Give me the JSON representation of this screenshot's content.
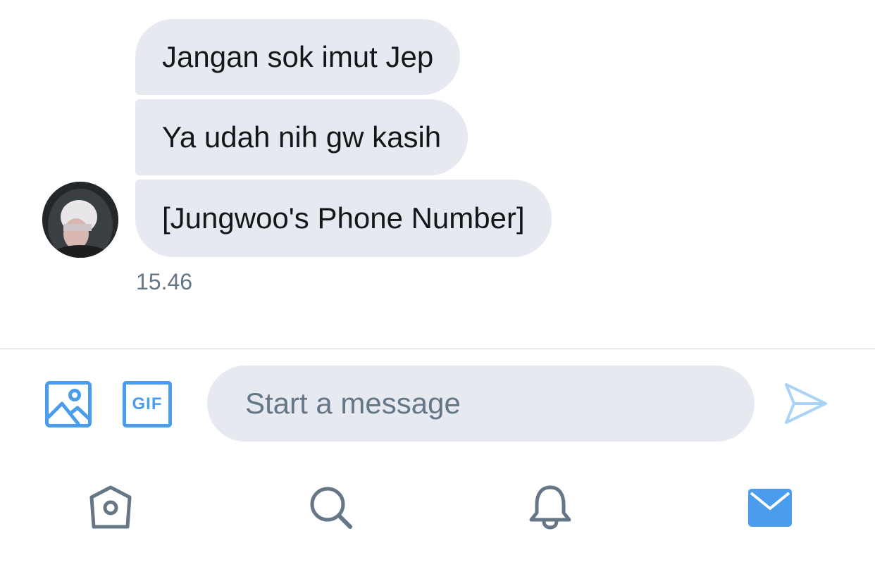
{
  "conversation": {
    "messages": [
      {
        "text": "Jangan sok imut Jep"
      },
      {
        "text": "Ya udah nih gw kasih"
      },
      {
        "text": "[Jungwoo's Phone Number]"
      }
    ],
    "timestamp": "15.46",
    "avatar_icon": "user-avatar"
  },
  "composer": {
    "photo_icon": "image-icon",
    "gif_label": "GIF",
    "placeholder": "Start a message",
    "send_icon": "send-icon"
  },
  "bottom_nav": {
    "items": [
      {
        "icon": "home-icon",
        "active": false
      },
      {
        "icon": "search-icon",
        "active": false
      },
      {
        "icon": "bell-icon",
        "active": false
      },
      {
        "icon": "mail-icon",
        "active": true
      }
    ]
  },
  "colors": {
    "accent": "#1da1f2",
    "icon_blue": "#4a9ded",
    "bubble": "#e6e9ef",
    "muted_text": "#657786",
    "nav_gray": "#657786"
  }
}
